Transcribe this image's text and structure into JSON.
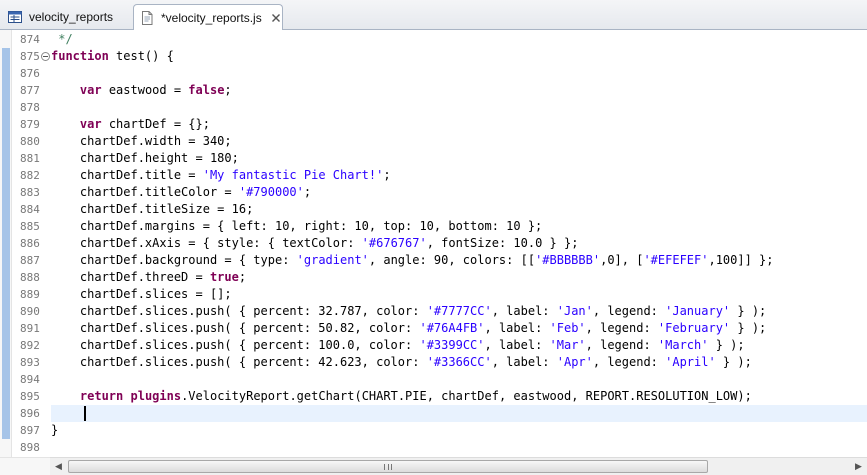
{
  "tabs": [
    {
      "label": "velocity_reports",
      "icon": "report-editor-icon",
      "active": false
    },
    {
      "label": "*velocity_reports.js",
      "icon": "js-file-icon",
      "active": true,
      "close_icon": "close-icon"
    }
  ],
  "editor": {
    "current_line_number": "896",
    "lines": [
      {
        "number": "874",
        "tokens": [
          {
            "t": " */",
            "c": "cmt"
          }
        ]
      },
      {
        "number": "875",
        "fold": true,
        "tokens": [
          {
            "t": "function",
            "c": "kw"
          },
          {
            "t": " test() {",
            "c": ""
          }
        ]
      },
      {
        "number": "876",
        "tokens": []
      },
      {
        "number": "877",
        "tokens": [
          {
            "t": "    ",
            "c": ""
          },
          {
            "t": "var",
            "c": "kw"
          },
          {
            "t": " eastwood = ",
            "c": ""
          },
          {
            "t": "false",
            "c": "kw"
          },
          {
            "t": ";",
            "c": ""
          }
        ]
      },
      {
        "number": "878",
        "tokens": []
      },
      {
        "number": "879",
        "tokens": [
          {
            "t": "    ",
            "c": ""
          },
          {
            "t": "var",
            "c": "kw"
          },
          {
            "t": " chartDef = {};",
            "c": ""
          }
        ]
      },
      {
        "number": "880",
        "tokens": [
          {
            "t": "    chartDef.width = 340;",
            "c": ""
          }
        ]
      },
      {
        "number": "881",
        "tokens": [
          {
            "t": "    chartDef.height = 180;",
            "c": ""
          }
        ]
      },
      {
        "number": "882",
        "tokens": [
          {
            "t": "    chartDef.title = ",
            "c": ""
          },
          {
            "t": "'My fantastic Pie Chart!'",
            "c": "str"
          },
          {
            "t": ";",
            "c": ""
          }
        ]
      },
      {
        "number": "883",
        "tokens": [
          {
            "t": "    chartDef.titleColor = ",
            "c": ""
          },
          {
            "t": "'#790000'",
            "c": "str"
          },
          {
            "t": ";",
            "c": ""
          }
        ]
      },
      {
        "number": "884",
        "tokens": [
          {
            "t": "    chartDef.titleSize = 16;",
            "c": ""
          }
        ]
      },
      {
        "number": "885",
        "tokens": [
          {
            "t": "    chartDef.margins = { left: 10, right: 10, top: 10, bottom: 10 };",
            "c": ""
          }
        ]
      },
      {
        "number": "886",
        "tokens": [
          {
            "t": "    chartDef.xAxis = { style: { textColor: ",
            "c": ""
          },
          {
            "t": "'#676767'",
            "c": "str"
          },
          {
            "t": ", fontSize: 10.0 } };",
            "c": ""
          }
        ]
      },
      {
        "number": "887",
        "tokens": [
          {
            "t": "    chartDef.background = { type: ",
            "c": ""
          },
          {
            "t": "'gradient'",
            "c": "str"
          },
          {
            "t": ", angle: 90, colors: [[",
            "c": ""
          },
          {
            "t": "'#BBBBBB'",
            "c": "str"
          },
          {
            "t": ",0], [",
            "c": ""
          },
          {
            "t": "'#EFEFEF'",
            "c": "str"
          },
          {
            "t": ",100]] };",
            "c": ""
          }
        ]
      },
      {
        "number": "888",
        "tokens": [
          {
            "t": "    chartDef.threeD = ",
            "c": ""
          },
          {
            "t": "true",
            "c": "kw"
          },
          {
            "t": ";",
            "c": ""
          }
        ]
      },
      {
        "number": "889",
        "tokens": [
          {
            "t": "    chartDef.slices = [];",
            "c": ""
          }
        ]
      },
      {
        "number": "890",
        "tokens": [
          {
            "t": "    chartDef.slices.push( { percent: 32.787, color: ",
            "c": ""
          },
          {
            "t": "'#7777CC'",
            "c": "str"
          },
          {
            "t": ", label: ",
            "c": ""
          },
          {
            "t": "'Jan'",
            "c": "str"
          },
          {
            "t": ", legend: ",
            "c": ""
          },
          {
            "t": "'January'",
            "c": "str"
          },
          {
            "t": " } );",
            "c": ""
          }
        ]
      },
      {
        "number": "891",
        "tokens": [
          {
            "t": "    chartDef.slices.push( { percent: 50.82, color: ",
            "c": ""
          },
          {
            "t": "'#76A4FB'",
            "c": "str"
          },
          {
            "t": ", label: ",
            "c": ""
          },
          {
            "t": "'Feb'",
            "c": "str"
          },
          {
            "t": ", legend: ",
            "c": ""
          },
          {
            "t": "'February'",
            "c": "str"
          },
          {
            "t": " } );",
            "c": ""
          }
        ]
      },
      {
        "number": "892",
        "tokens": [
          {
            "t": "    chartDef.slices.push( { percent: 100.0, color: ",
            "c": ""
          },
          {
            "t": "'#3399CC'",
            "c": "str"
          },
          {
            "t": ", label: ",
            "c": ""
          },
          {
            "t": "'Mar'",
            "c": "str"
          },
          {
            "t": ", legend: ",
            "c": ""
          },
          {
            "t": "'March'",
            "c": "str"
          },
          {
            "t": " } );",
            "c": ""
          }
        ]
      },
      {
        "number": "893",
        "tokens": [
          {
            "t": "    chartDef.slices.push( { percent: 42.623, color: ",
            "c": ""
          },
          {
            "t": "'#3366CC'",
            "c": "str"
          },
          {
            "t": ", label: ",
            "c": ""
          },
          {
            "t": "'Apr'",
            "c": "str"
          },
          {
            "t": ", legend: ",
            "c": ""
          },
          {
            "t": "'April'",
            "c": "str"
          },
          {
            "t": " } );",
            "c": ""
          }
        ]
      },
      {
        "number": "894",
        "tokens": []
      },
      {
        "number": "895",
        "tokens": [
          {
            "t": "    ",
            "c": ""
          },
          {
            "t": "return",
            "c": "kw"
          },
          {
            "t": " ",
            "c": ""
          },
          {
            "t": "plugins",
            "c": "kw"
          },
          {
            "t": ".VelocityReport.getChart(CHART.PIE, chartDef, eastwood, REPORT.RESOLUTION_LOW);",
            "c": ""
          }
        ]
      },
      {
        "number": "896",
        "tokens": [],
        "current": true
      },
      {
        "number": "897",
        "tokens": [
          {
            "t": "}",
            "c": ""
          }
        ]
      },
      {
        "number": "898",
        "tokens": []
      }
    ]
  },
  "scrollbar": {
    "left_arrow": "◀",
    "right_arrow": "▶",
    "grip_icon": "scroll-grip-icon"
  },
  "colors": {
    "keyword": "#7f0055",
    "string": "#2a00ff",
    "comment": "#3f7f5f",
    "current_line": "#e8f2fe",
    "ruler_mark": "#a6c4e8"
  }
}
